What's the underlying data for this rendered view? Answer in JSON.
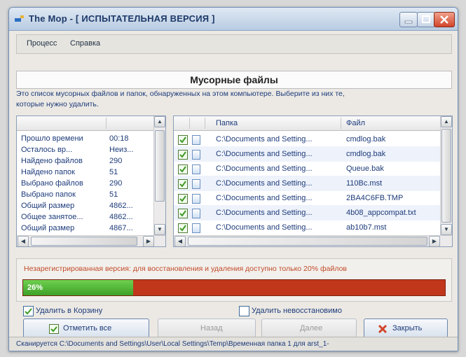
{
  "window": {
    "title": "The Mop - [ ИСПЫТАТЕЛЬНАЯ ВЕРСИЯ ]"
  },
  "menu": {
    "items": [
      "Процесс",
      "Справка"
    ]
  },
  "banner": {
    "title": "Мусорные файлы"
  },
  "description": {
    "line1": "Это список мусорных файлов и папок, обнаруженных на этом компьютере. Выберите из них те,",
    "line2": "которые нужно удалить."
  },
  "stats": {
    "rows": [
      {
        "label": "Прошло времени",
        "value": "00:18"
      },
      {
        "label": "Осталось вр...",
        "value": "Неиз..."
      },
      {
        "label": "Найдено файлов",
        "value": "290"
      },
      {
        "label": "Найдено папок",
        "value": "51"
      },
      {
        "label": "Выбрано файлов",
        "value": "290"
      },
      {
        "label": "Выбрано папок",
        "value": "51"
      },
      {
        "label": "Общий размер",
        "value": "4862..."
      },
      {
        "label": "Общее занятое...",
        "value": "4862..."
      },
      {
        "label": "Общий размер",
        "value": "4867..."
      }
    ]
  },
  "files": {
    "headers": {
      "folder": "Папка",
      "file": "Файл"
    },
    "rows": [
      {
        "folder": "C:\\Documents and Setting...",
        "file": "cmdlog.bak",
        "checked": true
      },
      {
        "folder": "C:\\Documents and Setting...",
        "file": "cmdlog.bak",
        "checked": true
      },
      {
        "folder": "C:\\Documents and Setting...",
        "file": "Queue.bak",
        "checked": true
      },
      {
        "folder": "C:\\Documents and Setting...",
        "file": "110Bc.mst",
        "checked": true
      },
      {
        "folder": "C:\\Documents and Setting...",
        "file": "2BA4C6FB.TMP",
        "checked": true
      },
      {
        "folder": "C:\\Documents and Setting...",
        "file": "4b08_appcompat.txt",
        "checked": true
      },
      {
        "folder": "C:\\Documents and Setting...",
        "file": "ab10b7.mst",
        "checked": true
      }
    ]
  },
  "notice": {
    "text": "Незарегистрированная версия: для восстановления и удаления доступно только 20% файлов"
  },
  "progress": {
    "percent": 26,
    "label": "26%"
  },
  "options": {
    "recycle": {
      "label": "Удалить в Корзину",
      "checked": true
    },
    "permanent": {
      "label": "Удалить невосстановимо",
      "checked": false
    }
  },
  "buttons": {
    "select_all": "Отметить все",
    "back": "Назад",
    "next": "Далее",
    "close": "Закрыть"
  },
  "status": {
    "text": "Сканируется C:\\Documents and Settings\\User\\Local Settings\\Temp\\Временная папка 1 для arst_1-"
  },
  "colors": {
    "progress_fill": "#3da128",
    "progress_track": "#c0371b",
    "accent": "#1d3b7a"
  }
}
